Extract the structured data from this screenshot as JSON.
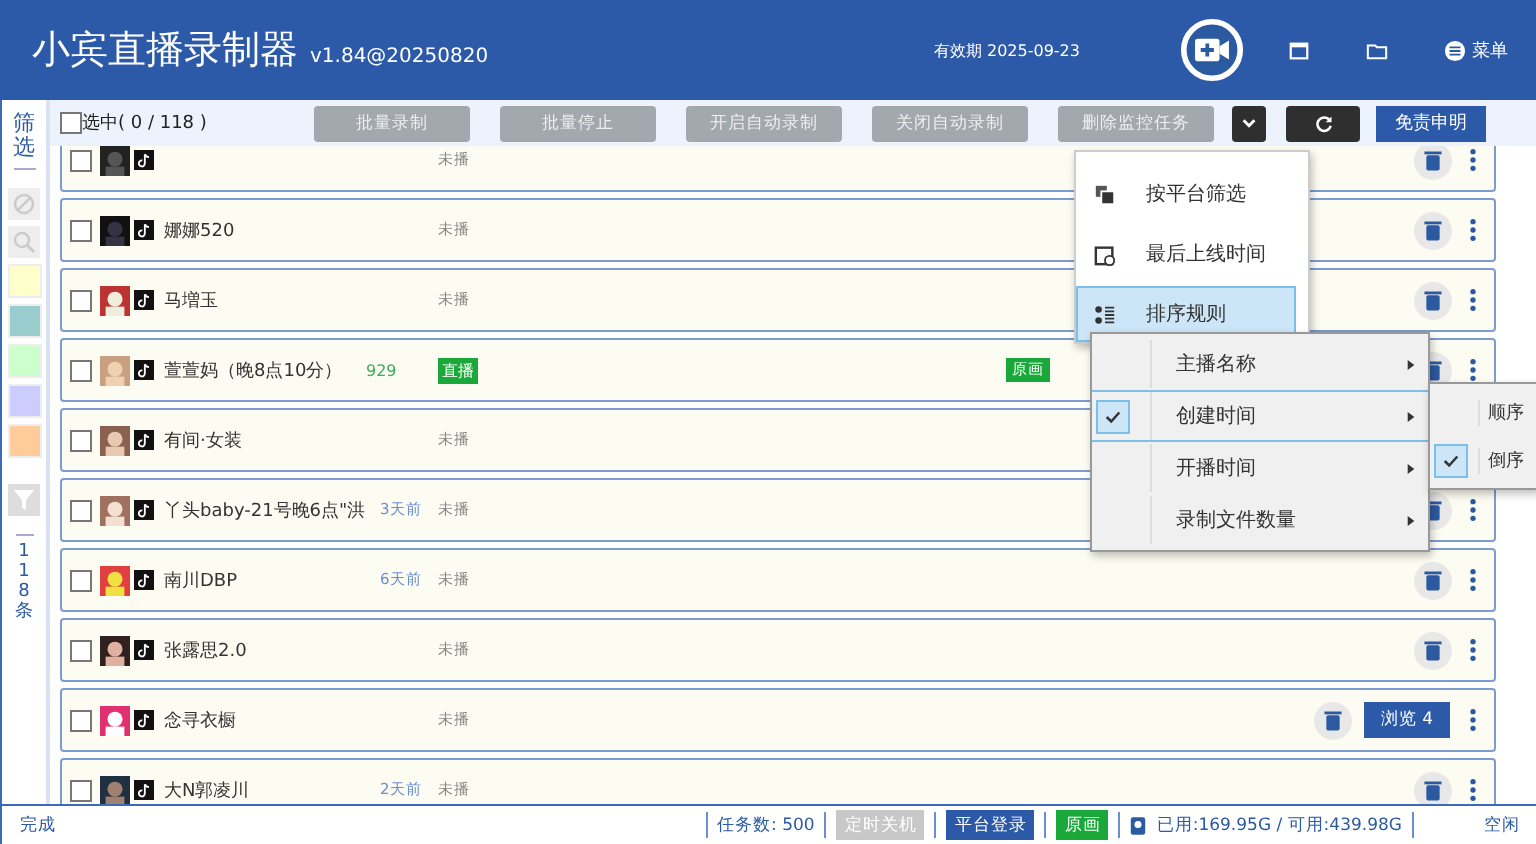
{
  "header": {
    "title": "小宾直播录制器",
    "version": "v1.84@20250820",
    "expiry": "有效期 2025-09-23",
    "menu_label": "菜单"
  },
  "toolbar": {
    "select_all": {
      "label": "选中( 0 / 118 )",
      "checked": false
    },
    "buttons": [
      {
        "label": "批量录制",
        "disabled": true
      },
      {
        "label": "批量停止",
        "disabled": true
      },
      {
        "label": "开启自动录制",
        "disabled": true
      },
      {
        "label": "关闭自动录制",
        "disabled": true
      },
      {
        "label": "删除监控任务",
        "disabled": true
      }
    ],
    "disclaimer": "免责申明"
  },
  "sidebar": {
    "filter_label": "筛选",
    "color_filters": [
      {
        "color": "#ffffcc"
      },
      {
        "color": "#99cccc"
      },
      {
        "color": "#ccffcc"
      },
      {
        "color": "#ccccff"
      },
      {
        "color": "#ffcc99"
      }
    ],
    "count": "118条"
  },
  "streamers": [
    {
      "checked": false,
      "status": "未播",
      "live": false
    },
    {
      "checked": false,
      "name": "娜娜520",
      "status": "未播",
      "live": false
    },
    {
      "checked": false,
      "name": "马増玉",
      "status": "未播",
      "live": false
    },
    {
      "checked": false,
      "name": "萱萱妈（晚8点10分）",
      "viewers": "929",
      "status": "直播",
      "live": true,
      "quality": "原画"
    },
    {
      "checked": false,
      "name": "有间·女装",
      "status": "未播",
      "live": false
    },
    {
      "checked": false,
      "name": "丫头baby-21号晚6点\"洪",
      "ago": "3天前",
      "status": "未播",
      "live": false
    },
    {
      "checked": false,
      "name": "南川DBP",
      "ago": "6天前",
      "status": "未播",
      "live": false
    },
    {
      "checked": false,
      "name": "张露思2.0",
      "status": "未播",
      "live": false
    },
    {
      "checked": false,
      "name": "念寻衣橱",
      "status": "未播",
      "live": false,
      "browse": "浏览 4"
    },
    {
      "checked": false,
      "name": "大N郭凌川",
      "ago": "2天前",
      "status": "未播",
      "live": false
    }
  ],
  "context_menu": {
    "items": [
      {
        "label": "按平台筛选",
        "selected": false
      },
      {
        "label": "最后上线时间",
        "selected": false
      },
      {
        "label": "排序规则",
        "selected": true
      }
    ],
    "submenu": [
      {
        "label": "主播名称",
        "checked": false,
        "selected": false
      },
      {
        "label": "创建时间",
        "checked": true,
        "selected": true
      },
      {
        "label": "开播时间",
        "checked": false,
        "selected": false
      },
      {
        "label": "录制文件数量",
        "checked": false,
        "selected": false
      }
    ],
    "order_menu": [
      {
        "label": "顺序",
        "checked": false
      },
      {
        "label": "倒序",
        "checked": true
      }
    ]
  },
  "status_bar": {
    "state": "完成",
    "tasks": "任务数: 500",
    "shutdown": {
      "label": "定时关机",
      "disabled": true
    },
    "login": "平台登录",
    "quality": "原画",
    "disk": "已用:169.95G / 可用:439.98G",
    "idle": "空闲"
  }
}
